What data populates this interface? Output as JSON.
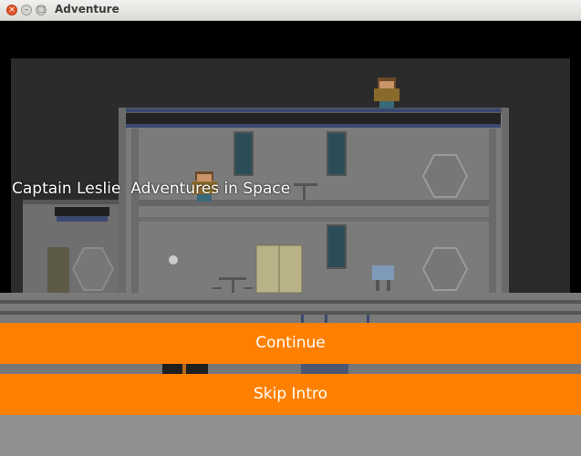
{
  "window": {
    "title": "Adventure",
    "close_glyph": "×",
    "minimize_glyph": "–",
    "maximize_glyph": "□"
  },
  "intro": {
    "story_text": "Captain Leslie  Adventures in Space"
  },
  "buttons": {
    "continue_label": "Continue",
    "skip_label": "Skip Intro"
  },
  "colors": {
    "button_bg": "#ff8000",
    "button_text": "#ffffff",
    "scene_bg": "#2c2c2c",
    "window_bg": "#000000"
  }
}
